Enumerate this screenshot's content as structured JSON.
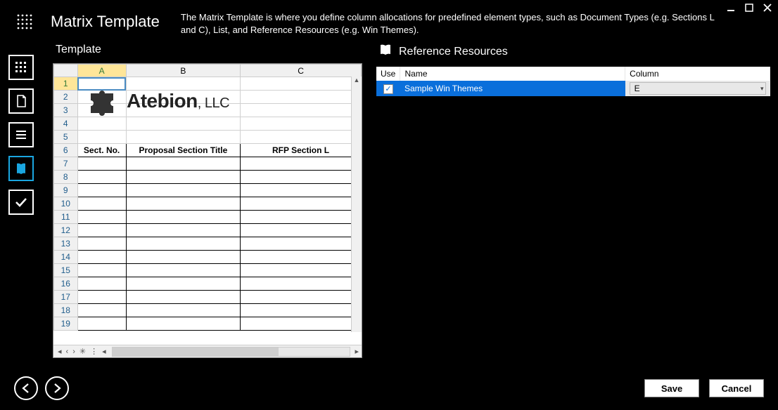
{
  "window": {
    "title": "Matrix Template",
    "description": "The Matrix Template is where you define column allocations for predefined element types, such as Document Types (e.g. Sections L and C), List, and Reference Resources (e.g. Win Themes)."
  },
  "sidebar": {
    "items": [
      {
        "name": "grid-icon"
      },
      {
        "name": "document-icon"
      },
      {
        "name": "list-icon"
      },
      {
        "name": "book-icon"
      },
      {
        "name": "check-icon"
      }
    ],
    "active_index": 3
  },
  "left": {
    "title": "Template",
    "columns": [
      "A",
      "B",
      "C"
    ],
    "selected_cell": "A1",
    "visible_rows": 19,
    "header_row_index": 6,
    "header_row": [
      "Sect. No.",
      "Proposal Section Title",
      "RFP Section L"
    ],
    "logo": {
      "company": "Atebion",
      "suffix": ", LLC"
    }
  },
  "right": {
    "title": "Reference Resources",
    "columns": [
      "Use",
      "Name",
      "Column"
    ],
    "rows": [
      {
        "use": true,
        "name": "Sample Win Themes",
        "column": "E",
        "selected": true
      }
    ]
  },
  "footer": {
    "save": "Save",
    "cancel": "Cancel"
  }
}
